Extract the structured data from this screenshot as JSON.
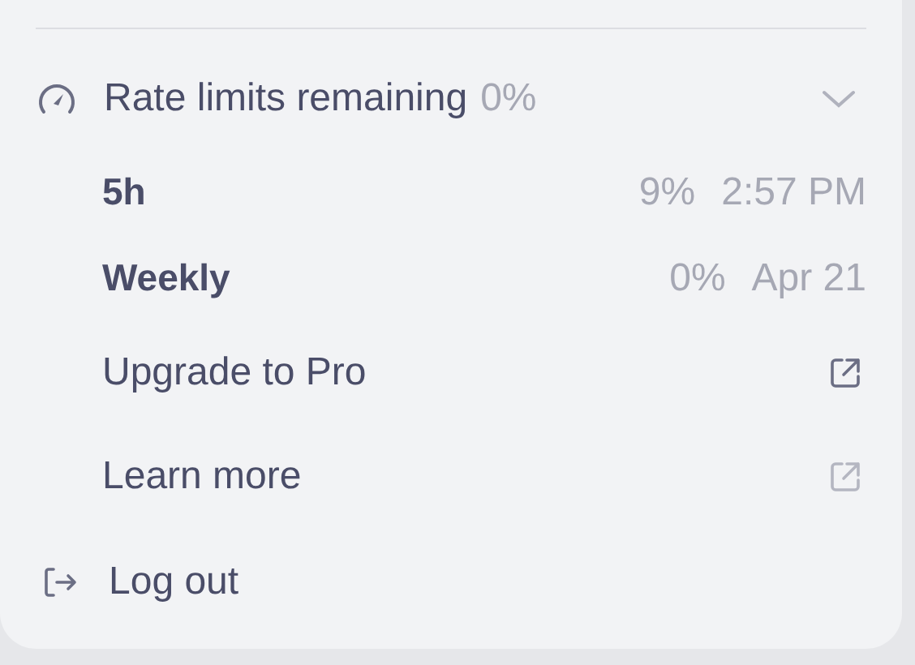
{
  "menu": {
    "rate_limits": {
      "label": "Rate limits remaining",
      "value": "0%",
      "expanded": true,
      "rows": [
        {
          "label": "5h",
          "percent": "9%",
          "reset": "2:57 PM"
        },
        {
          "label": "Weekly",
          "percent": "0%",
          "reset": "Apr 21"
        }
      ]
    },
    "links": [
      {
        "label": "Upgrade to Pro",
        "highlighted": true
      },
      {
        "label": "Learn more",
        "highlighted": false
      }
    ],
    "logout": {
      "label": "Log out"
    }
  }
}
